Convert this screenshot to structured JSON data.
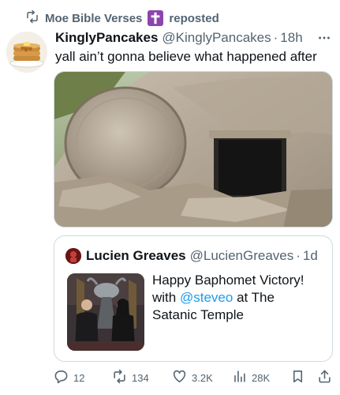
{
  "repost": {
    "label": "Moe Bible Verses",
    "suffix": "reposted",
    "badge_icon": "latin-cross-emoji"
  },
  "tweet": {
    "author_name": "KinglyPancakes",
    "author_handle": "@KinglyPancakes",
    "separator": "·",
    "time": "18h",
    "text": "yall ain’t gonna believe what happened after",
    "avatar_icon": "pancake-stack-avatar",
    "media_icon": "stone-tomb-photo"
  },
  "quote": {
    "author_name": "Lucien Greaves",
    "author_handle": "@LucienGreaves",
    "separator": "·",
    "time": "1d",
    "text_line1": "Happy Baphomet Victory!",
    "text_with": "with",
    "mention": "@steveo",
    "text_after": "at The",
    "text_line3": "Satanic Temple",
    "thumb_icon": "baphomet-statue-photo"
  },
  "actions": {
    "replies": "12",
    "reposts": "134",
    "likes": "3.2K",
    "views": "28K"
  },
  "colors": {
    "text": "#0f1419",
    "secondary": "#536471",
    "link": "#1d9bf0",
    "border": "#cfd9de",
    "badge": "#8e44ad"
  }
}
